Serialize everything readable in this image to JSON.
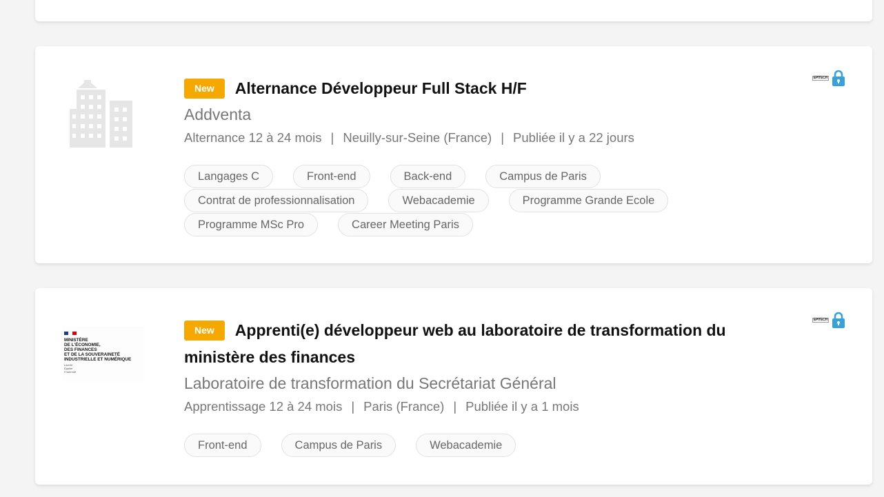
{
  "jobs": [
    {
      "badge": "New",
      "title": "Alternance Développeur Full Stack H/F",
      "company": "Addventa",
      "contract": "Alternance 12 à 24 mois",
      "location": "Neuilly-sur-Seine (France)",
      "published": "Publiée il y a 22 jours",
      "separator": "|",
      "tags": [
        "Langages C",
        "Front-end",
        "Back-end",
        "Campus de Paris",
        "Contrat de professionnalisation",
        "Webacademie",
        "Programme Grande Ecole",
        "Programme MSc Pro",
        "Career Meeting Paris"
      ],
      "logo_icon": "building-icon",
      "partner_logo": "EPITECH",
      "status_icon": "lock-icon"
    },
    {
      "badge": "New",
      "title": "Apprenti(e) développeur web au laboratoire de transformation du ministère des finances",
      "company": "Laboratoire de transformation du Secrétariat Général",
      "contract": "Apprentissage 12 à 24 mois",
      "location": "Paris (France)",
      "published": "Publiée il y a 1 mois",
      "separator": "|",
      "tags": [
        "Front-end",
        "Campus de Paris",
        "Webacademie"
      ],
      "logo_lines": [
        "MINISTÈRE",
        "DE L'ÉCONOMIE,",
        "DES FINANCES",
        "ET DE LA SOUVERAINETÉ",
        "INDUSTRIELLE ET NUMÉRIQUE"
      ],
      "logo_motto": [
        "Liberté",
        "Égalité",
        "Fraternité"
      ],
      "partner_logo": "EPITECH",
      "status_icon": "lock-icon"
    }
  ],
  "colors": {
    "badge": "#f5a800",
    "lock": "#3aa0d8",
    "background": "#f4f4f5"
  }
}
